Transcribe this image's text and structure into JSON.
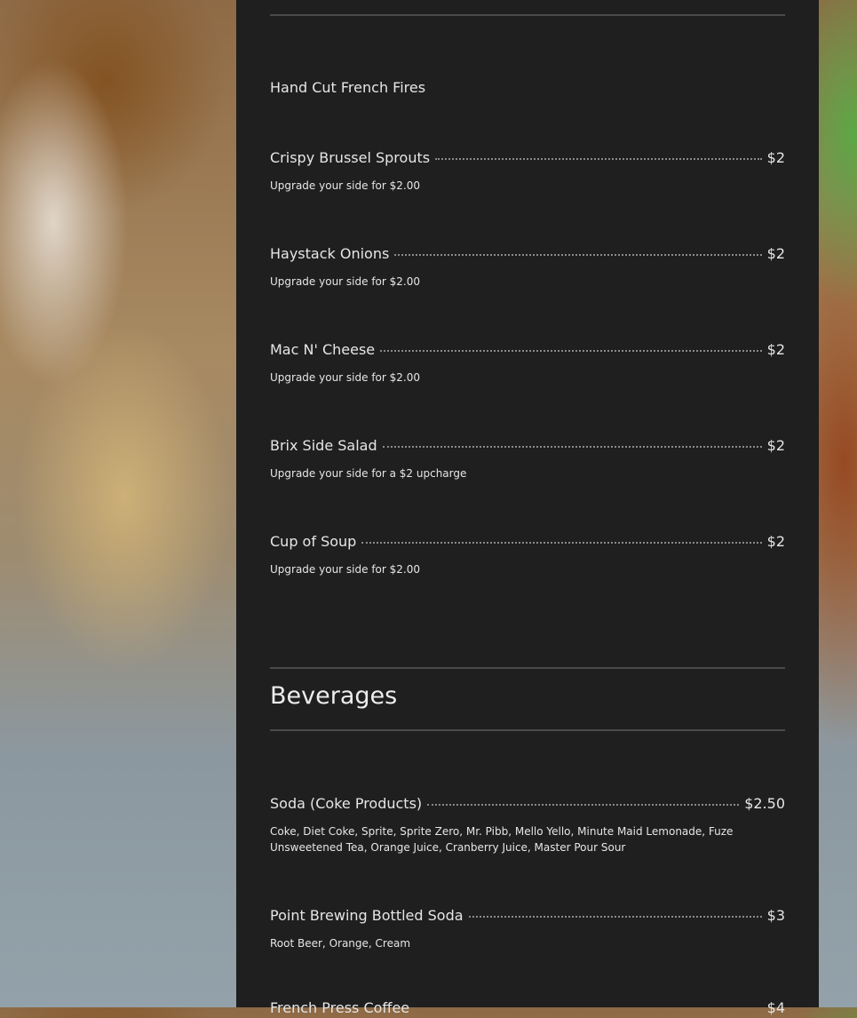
{
  "standalone_item": "Hand Cut French Fires",
  "sides": [
    {
      "name": "Crispy Brussel Sprouts",
      "price": "$2",
      "description": "Upgrade your side for $2.00"
    },
    {
      "name": "Haystack Onions",
      "price": "$2",
      "description": "Upgrade your side for $2.00"
    },
    {
      "name": "Mac N' Cheese",
      "price": "$2",
      "description": "Upgrade your side for $2.00"
    },
    {
      "name": "Brix Side Salad",
      "price": "$2",
      "description": "Upgrade your side for a $2 upcharge"
    },
    {
      "name": "Cup of Soup",
      "price": "$2",
      "description": "Upgrade your side for $2.00"
    }
  ],
  "beverages": {
    "title": "Beverages",
    "items": [
      {
        "name": "Soda (Coke Products)",
        "price": "$2.50",
        "description": "Coke, Diet Coke, Sprite, Sprite Zero, Mr. Pibb, Mello Yello, Minute Maid Lemonade, Fuze Unsweetened Tea, Orange Juice, Cranberry Juice, Master Pour Sour"
      },
      {
        "name": "Point Brewing Bottled Soda",
        "price": "$3",
        "description": "Root Beer, Orange, Cream"
      },
      {
        "name": "French Press Coffee",
        "price": "$4",
        "description": ""
      }
    ]
  },
  "colors": {
    "panel": "#1f1f1f",
    "text": "#e6e6e6",
    "rule": "#4a4a4a"
  }
}
